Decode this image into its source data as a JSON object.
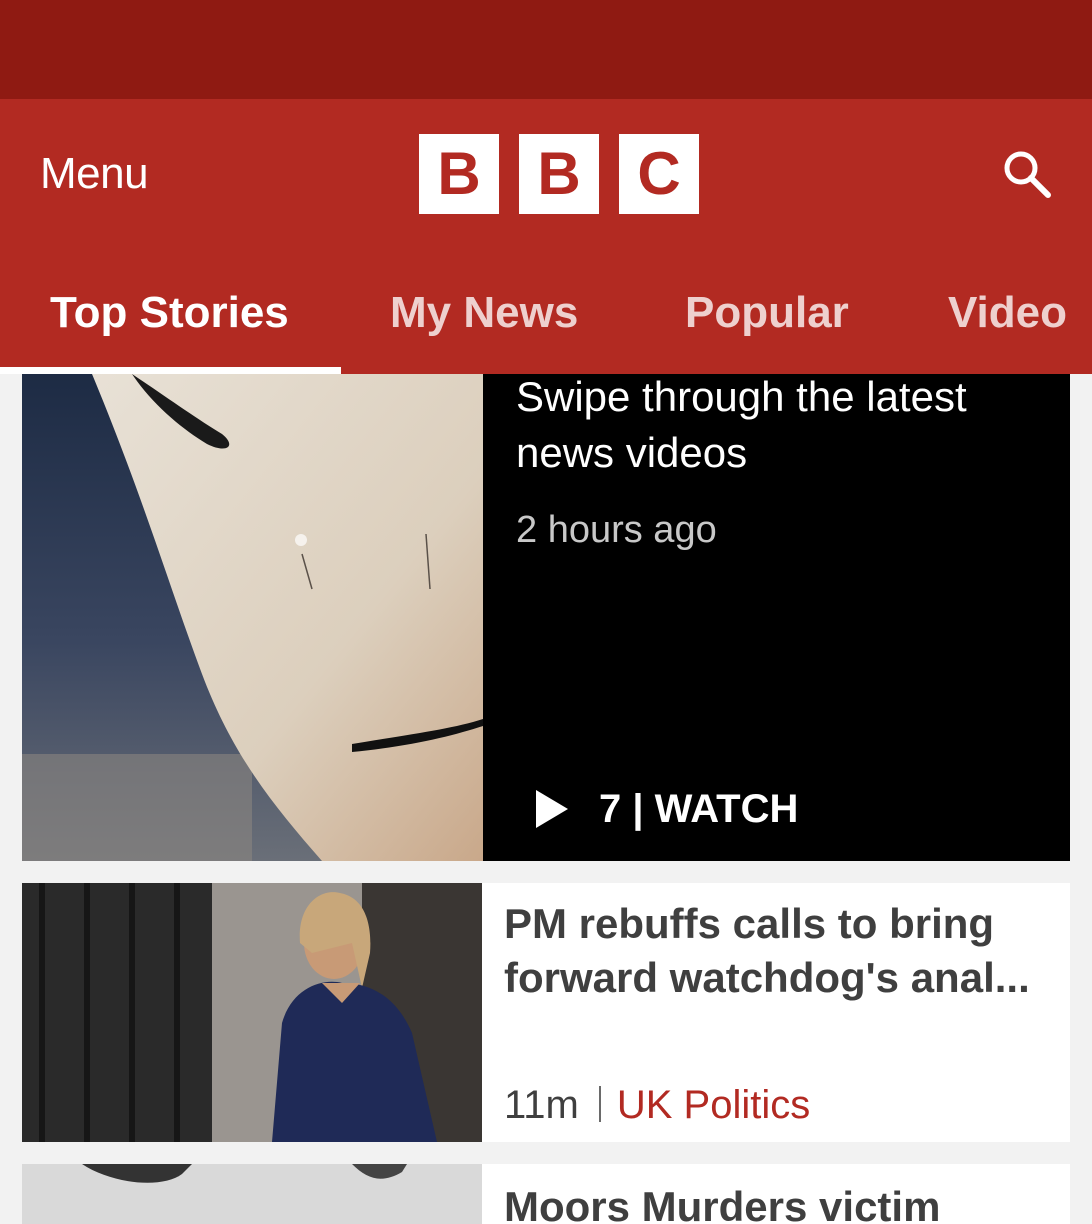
{
  "header": {
    "menu_label": "Menu",
    "logo_letters": [
      "B",
      "B",
      "C"
    ],
    "search_icon": "search-icon"
  },
  "tabs": [
    {
      "label": "Top Stories",
      "active": true
    },
    {
      "label": "My News",
      "active": false
    },
    {
      "label": "Popular",
      "active": false
    },
    {
      "label": "Video",
      "active": false
    }
  ],
  "video_card": {
    "title": "Swipe through the latest news videos",
    "time": "2 hours ago",
    "watch_label": "7 | WATCH",
    "play_icon": "play-icon"
  },
  "story_card": {
    "title": "PM rebuffs calls to bring forward watchdog's anal...",
    "time": "11m",
    "category": "UK Politics"
  },
  "next_card": {
    "title_partial": "Moors Murders victim"
  },
  "colors": {
    "brand_red": "#b22a22",
    "status_bar": "#8f1a12",
    "background": "#f2f2f2"
  }
}
